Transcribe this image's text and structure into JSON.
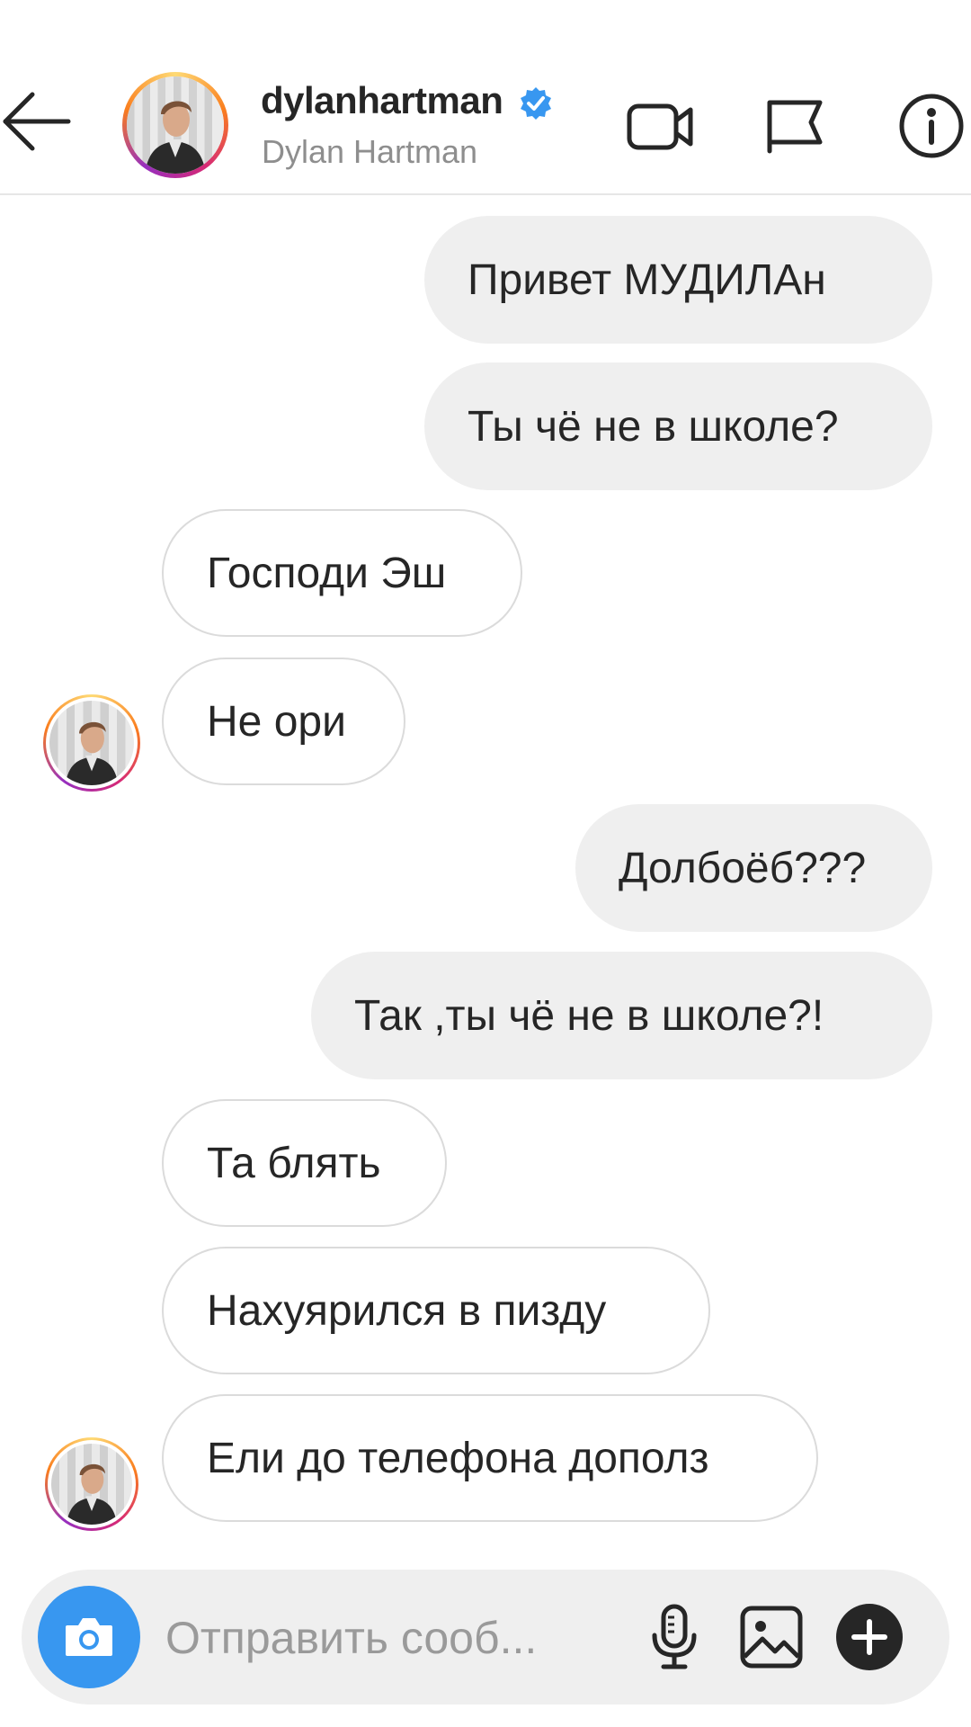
{
  "header": {
    "username": "dylanhartman",
    "full_name": "Dylan Hartman",
    "verified": true,
    "icons": [
      "back-arrow-icon",
      "video-call-icon",
      "flag-icon",
      "info-icon"
    ]
  },
  "messages": [
    {
      "direction": "outgoing",
      "text": "Привет МУДИЛАн"
    },
    {
      "direction": "outgoing",
      "text": "Ты чё не в школе?"
    },
    {
      "direction": "incoming",
      "text": "Господи Эш"
    },
    {
      "direction": "incoming",
      "text": "Не ори"
    },
    {
      "direction": "outgoing",
      "text": "Долбоёб???"
    },
    {
      "direction": "outgoing",
      "text": "Так ,ты чё не в школе?!"
    },
    {
      "direction": "incoming",
      "text": "Та блять"
    },
    {
      "direction": "incoming",
      "text": "Нахуярился в пизду"
    },
    {
      "direction": "incoming",
      "text": "Ели до телефона дополз"
    }
  ],
  "composer": {
    "placeholder": "Отправить сооб...",
    "icons": [
      "camera-icon",
      "microphone-icon",
      "gallery-icon",
      "plus-icon"
    ]
  },
  "colors": {
    "accent_blue": "#3897f0",
    "verified_blue": "#3897f0",
    "outgoing_bubble": "#efefef",
    "incoming_border": "#dbdbdb",
    "text": "#262626",
    "secondary_text": "#8e8e8e"
  }
}
